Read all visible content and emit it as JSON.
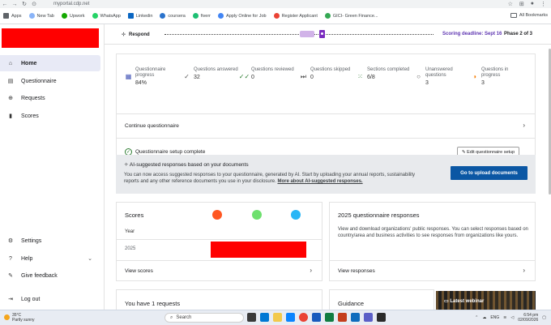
{
  "browser": {
    "url": "myportal.cdp.net",
    "bookmarks": [
      {
        "label": "Apps",
        "color": "#5f6368"
      },
      {
        "label": "New Tab",
        "color": "#8ab4f8"
      },
      {
        "label": "Upwork",
        "color": "#14a800"
      },
      {
        "label": "WhatsApp",
        "color": "#25d366"
      },
      {
        "label": "Linkedin",
        "color": "#0a66c2"
      },
      {
        "label": "coursera",
        "color": "#2a73cc"
      },
      {
        "label": "fiverr",
        "color": "#1dbf73"
      },
      {
        "label": "Apply Online for Job",
        "color": "#4285f4"
      },
      {
        "label": "Register Applicant",
        "color": "#ea4335"
      },
      {
        "label": "GICI- Green Finance...",
        "color": "#34a853"
      }
    ],
    "all_bookmarks": "All Bookmarks"
  },
  "sidebar": {
    "items": [
      {
        "label": "Home",
        "icon": "home-icon"
      },
      {
        "label": "Questionnaire",
        "icon": "document-icon"
      },
      {
        "label": "Requests",
        "icon": "chat-plus-icon"
      },
      {
        "label": "Scores",
        "icon": "bar-chart-icon"
      }
    ],
    "bottom": [
      {
        "label": "Settings",
        "icon": "gear-icon"
      },
      {
        "label": "Help",
        "icon": "help-icon"
      },
      {
        "label": "Give feedback",
        "icon": "feedback-icon"
      },
      {
        "label": "Log out",
        "icon": "logout-icon"
      }
    ]
  },
  "progress": {
    "step": "Respond",
    "deadline": "Scoring deadline: Sept 16",
    "phase": "Phase 2 of 3"
  },
  "stats": [
    {
      "label": "Questionnaire progress",
      "value": "84%"
    },
    {
      "label": "Questions answered",
      "value": "32"
    },
    {
      "label": "Questions reviewed",
      "value": "0"
    },
    {
      "label": "Questions skipped",
      "value": "0"
    },
    {
      "label": "Sections completed",
      "value": "6/8"
    },
    {
      "label": "Unanswered questions",
      "value": "3"
    },
    {
      "label": "Questions in progress",
      "value": "3"
    }
  ],
  "questionnaire": {
    "continue": "Continue questionnaire",
    "setup_complete": "Questionnaire setup complete",
    "edit_button": "Edit questionnaire setup"
  },
  "ai": {
    "title": "AI-suggested responses based on your documents",
    "body": "You can now access suggested responses to your questionnaire, generated by AI. Start by uploading your annual reports, sustainability reports and any other reference documents you use in your disclosure.",
    "link": "More about AI-suggested responses.",
    "button": "Go to upload documents"
  },
  "scores": {
    "title": "Scores",
    "year_label": "Year",
    "year": "2025",
    "link": "View scores"
  },
  "responses": {
    "title": "2025 questionnaire responses",
    "body": "View and download organizations' public responses. You can select responses based on country/area and business activities to see responses from organizations like yours.",
    "link": "View responses"
  },
  "requests": {
    "title": "You have 1 requests"
  },
  "guidance": {
    "title": "Guidance"
  },
  "webinar": {
    "label": "Latest webinar"
  },
  "taskbar": {
    "temp": "35°C",
    "weather": "Partly sunny",
    "search": "Search",
    "time": "6:54 pm",
    "date": "02/09/2026",
    "lang": "ENG"
  }
}
